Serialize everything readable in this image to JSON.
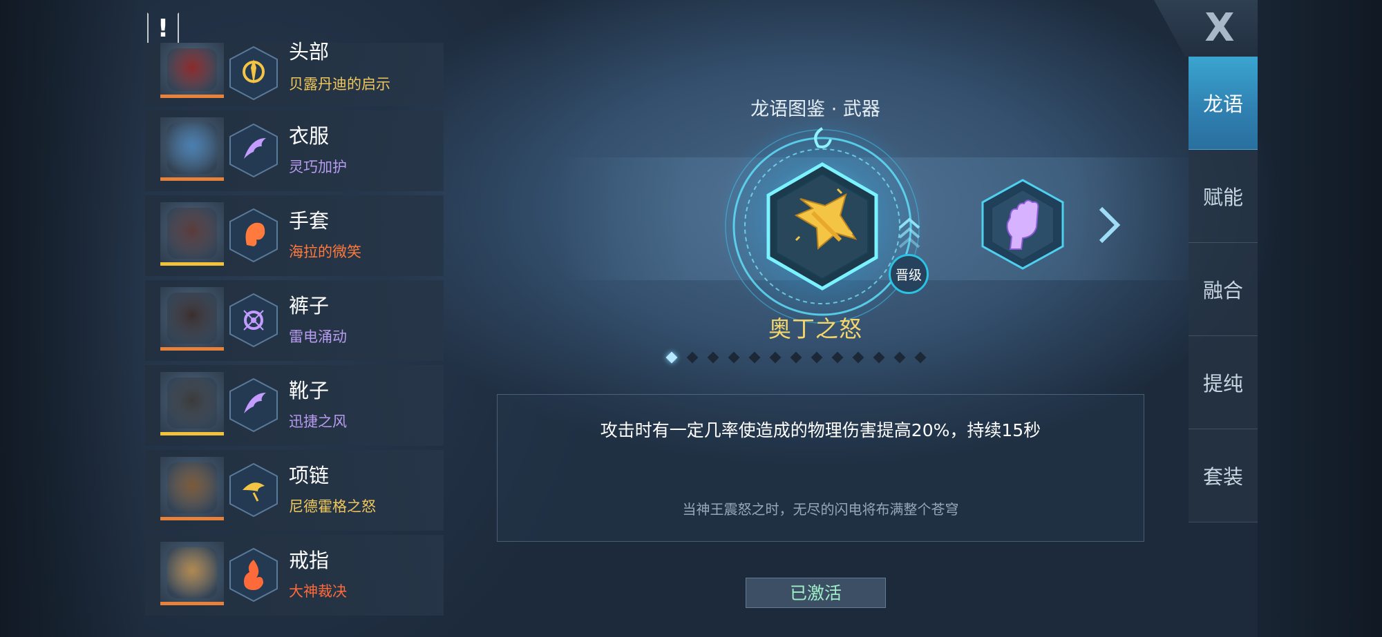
{
  "warning_icon": "exclamation-icon",
  "equipment": [
    {
      "slot": "头部",
      "rune": "贝露丹迪的启示",
      "rune_color": "#f0c75a",
      "bar_color": "#e8813a",
      "rune_icon": "gold-rune-icon"
    },
    {
      "slot": "衣服",
      "rune": "灵巧加护",
      "rune_color": "#b89cf0",
      "bar_color": "#e8813a",
      "rune_icon": "purple-wing-rune-icon"
    },
    {
      "slot": "手套",
      "rune": "海拉的微笑",
      "rune_color": "#ff7a3c",
      "bar_color": "#f2c33a",
      "rune_icon": "orange-face-rune-icon"
    },
    {
      "slot": "裤子",
      "rune": "雷电涌动",
      "rune_color": "#b89cf0",
      "bar_color": "#e8813a",
      "rune_icon": "purple-orb-rune-icon"
    },
    {
      "slot": "靴子",
      "rune": "迅捷之风",
      "rune_color": "#b89cf0",
      "bar_color": "#f2c33a",
      "rune_icon": "purple-wing-rune-icon"
    },
    {
      "slot": "项链",
      "rune": "尼德霍格之怒",
      "rune_color": "#f0c75a",
      "bar_color": "#e8813a",
      "rune_icon": "gold-dragon-rune-icon"
    },
    {
      "slot": "戒指",
      "rune": "大神裁决",
      "rune_color": "#ff6a3a",
      "bar_color": "#e8813a",
      "rune_icon": "orange-flame-rune-icon"
    }
  ],
  "panel": {
    "title": "龙语图鉴 · 武器",
    "weapon_name": "奥丁之怒",
    "promote_label": "晋级",
    "total_pages": 13,
    "active_page": 1,
    "description": "攻击时有一定几率使造成的物理伤害提高20%，持续15秒",
    "flavor": "当神王震怒之时，无尽的闪电将布满整个苍穹",
    "status_button": "已激活"
  },
  "close_label": "X",
  "tabs": [
    {
      "label": "龙语",
      "active": true
    },
    {
      "label": "赋能",
      "active": false
    },
    {
      "label": "融合",
      "active": false
    },
    {
      "label": "提纯",
      "active": false
    },
    {
      "label": "套装",
      "active": false
    }
  ]
}
